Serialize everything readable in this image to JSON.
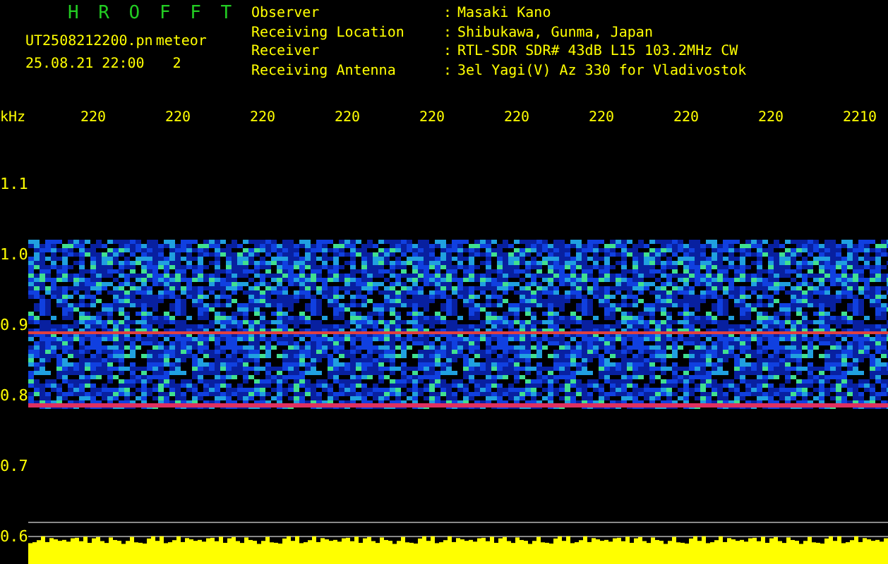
{
  "header": {
    "title": "H R O F F T",
    "filename": "UT2508212200.pn",
    "tag": "meteor",
    "datetime": "25.08.21 22:00",
    "count": "2"
  },
  "info": [
    {
      "label": "Observer",
      "separator": ":",
      "value": "Masaki Kano"
    },
    {
      "label": "Receiving Location",
      "separator": ":",
      "value": "Shibukawa, Gunma, Japan"
    },
    {
      "label": "Receiver",
      "separator": ":",
      "value": "RTL-SDR SDR# 43dB L15 103.2MHz CW"
    },
    {
      "label": "Receiving Antenna",
      "separator": ":",
      "value": "3el Yagi(V) Az 330 for Vladivostok"
    }
  ],
  "spectrogram": {
    "y_unit": "kHz",
    "x_ticks": [
      "220",
      "220",
      "220",
      "220",
      "220",
      "220",
      "220",
      "220",
      "220",
      "2210"
    ],
    "y_ticks": [
      "1.1",
      "1.0",
      "0.9",
      "0.8",
      "0.7",
      "0.6"
    ]
  }
}
